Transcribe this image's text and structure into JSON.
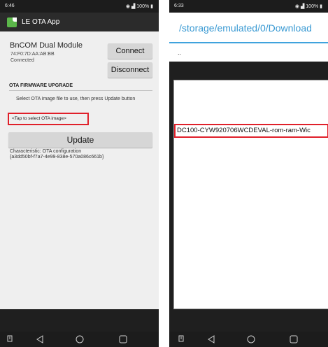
{
  "left_phone": {
    "status_bar": {
      "time": "6:46",
      "battery": "100%"
    },
    "app_title": "LE OTA App",
    "device": {
      "name": "BnCOM Dual Module",
      "address": "74:F0:7D:AA:AB:BB",
      "status": "Connected"
    },
    "buttons": {
      "connect": "Connect",
      "disconnect": "Disconnect",
      "update": "Update"
    },
    "section_header": "OTA FIRMWARE UPGRADE",
    "instruction": "Select OTA image file to use, then press Update button",
    "file_select": "<Tap to select OTA image>",
    "characteristic_label": "Characteristic: OTA configuration",
    "characteristic_uuid": "{a3dd50bf-f7a7-4e99-838e-570a086c661b}"
  },
  "right_phone": {
    "status_bar": {
      "time": "6:33",
      "battery": "100%"
    },
    "path": "/storage/emulated/0/Download",
    "parent_entry": "..",
    "file_entry": "DC100-CYW920706WCDEVAL-rom-ram-Wic"
  },
  "colors": {
    "accent": "#3a9ad3",
    "highlight": "#e0202a",
    "app_icon": "#5bb74a"
  },
  "icons": {
    "nav": [
      "recent-apps-icon",
      "back-icon",
      "home-icon",
      "overview-icon"
    ]
  }
}
